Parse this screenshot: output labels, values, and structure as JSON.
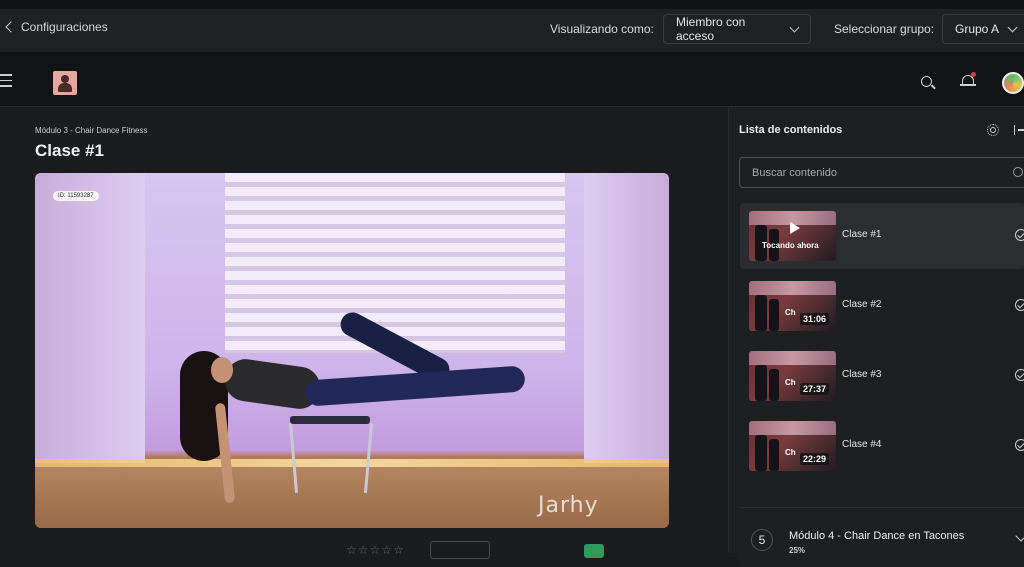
{
  "topbar": {
    "back_label": "Configuraciones",
    "viewing_label": "Visualizando como:",
    "viewing_value": "Miembro con acceso",
    "group_label": "Seleccionar grupo:",
    "group_value": "Grupo A"
  },
  "lesson": {
    "breadcrumb": "Módulo 3 - Chair Dance Fitness",
    "title": "Clase #1",
    "video_id": "ID: 11593287",
    "watermark": "Jarhy"
  },
  "panel": {
    "title": "Lista de contenidos",
    "search_placeholder": "Buscar contenido",
    "items": [
      {
        "title": "Clase #1",
        "status": "Tocando ahora",
        "duration": ""
      },
      {
        "title": "Clase #2",
        "status": "",
        "duration": "31:06"
      },
      {
        "title": "Clase #3",
        "status": "",
        "duration": "27:37"
      },
      {
        "title": "Clase #4",
        "status": "",
        "duration": "22:29"
      }
    ],
    "next_module": {
      "number": "5",
      "title": "Módulo 4 - Chair Dance en Tacones",
      "progress": "25%"
    }
  },
  "colors": {
    "background": "#1a1b1d",
    "panel": "#1e1f21",
    "active_item": "#2c2d30",
    "accent_green": "#2f9b5b",
    "notification": "#e03b3b"
  }
}
